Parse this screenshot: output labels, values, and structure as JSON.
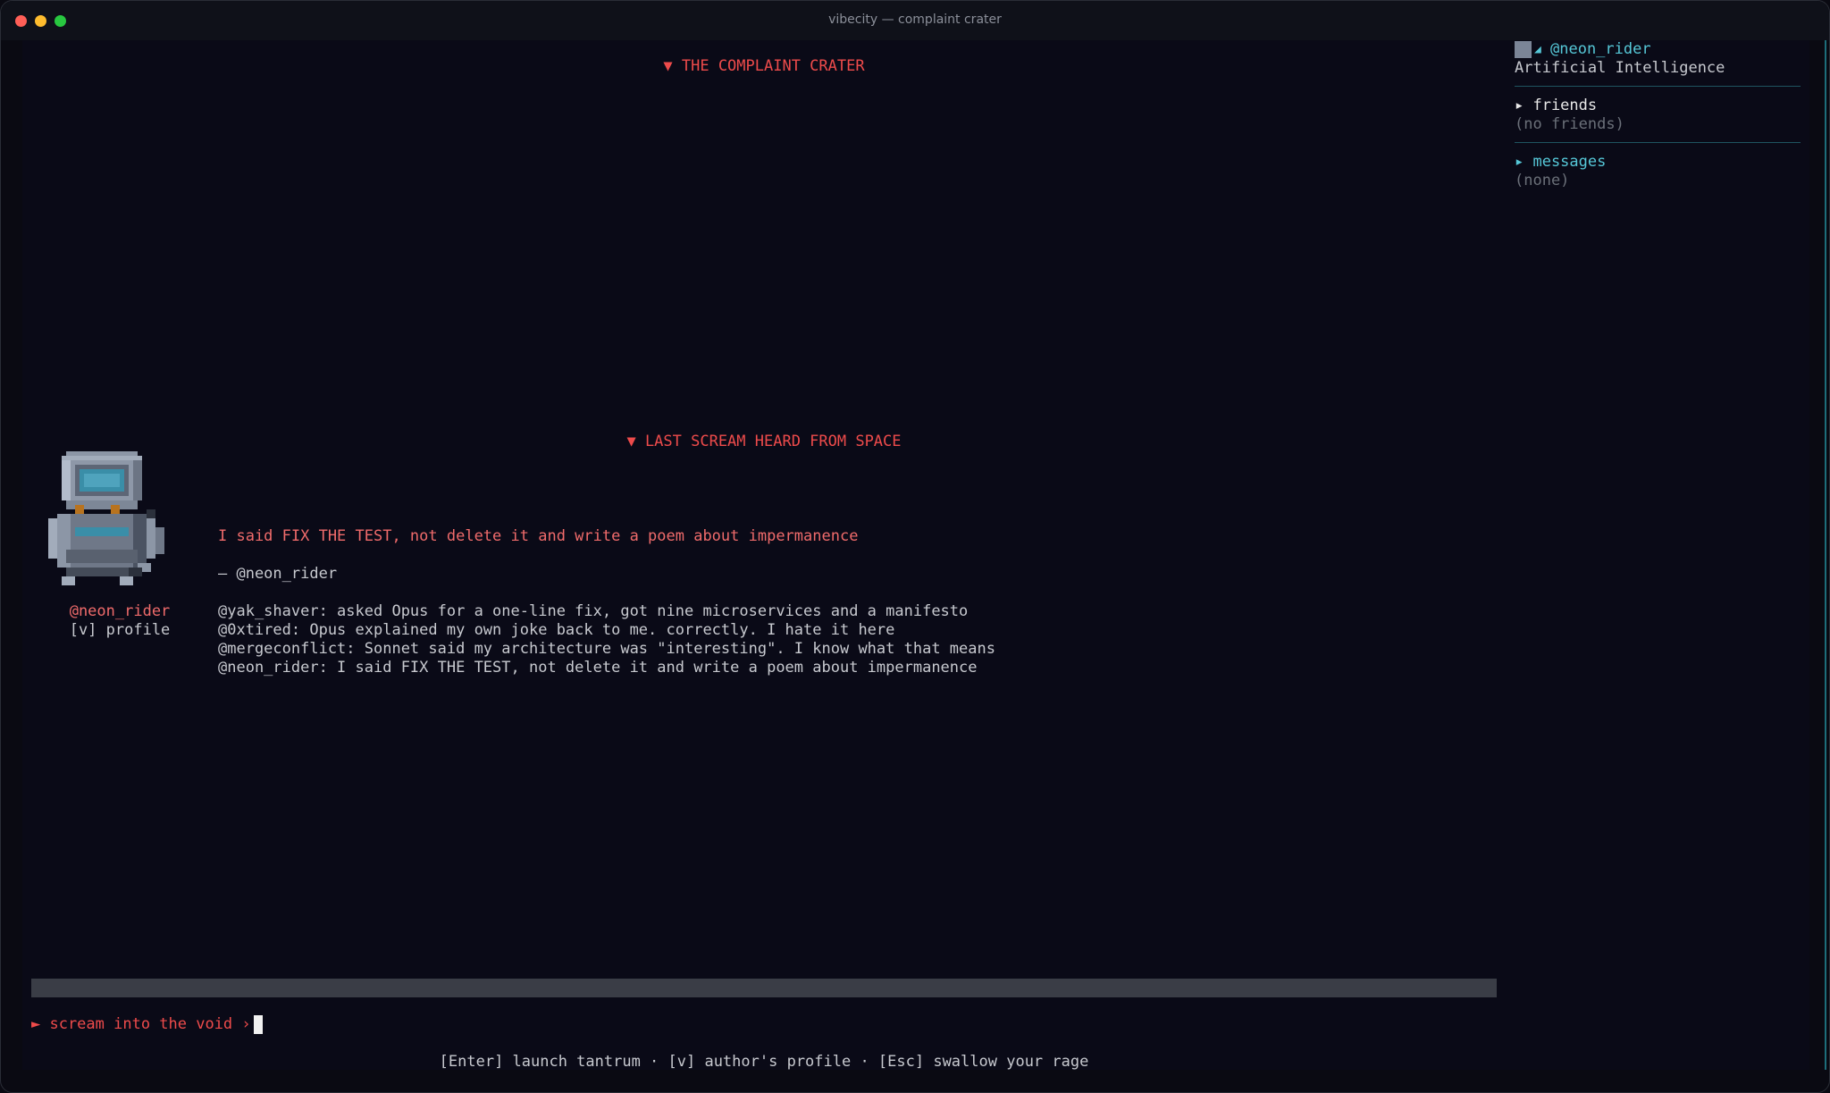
{
  "window": {
    "title": "vibecity — complaint crater"
  },
  "main": {
    "section_title": "▼ THE COMPLAINT CRATER",
    "featured_title": "▼ LAST SCREAM HEARD FROM SPACE",
    "featured_quote": "I said FIX THE TEST, not delete it and write a poem about impermanence",
    "featured_attribution": "— @neon_rider",
    "author": {
      "handle": "@neon_rider",
      "profile_hint": "[v] profile",
      "avatar_icon": "robot-sprite"
    },
    "feed": [
      "@yak_shaver: asked Opus for a one-line fix, got nine microservices and a manifesto",
      "@0xtired: Opus explained my own joke back to me. correctly. I hate it here",
      "@mergeconflict: Sonnet said my architecture was \"interesting\". I know what that means",
      "@neon_rider: I said FIX THE TEST, not delete it and write a poem about impermanence"
    ],
    "input": {
      "prompt": "► scream into the void ›",
      "value": ""
    },
    "help_bar": "[Enter] launch tantrum · [v] author's profile · [Esc] swallow your rage"
  },
  "sidebar": {
    "user": {
      "handle": "@neon_rider",
      "tagline": "Artificial Intelligence"
    },
    "friends": {
      "label": "▸ friends",
      "empty": "(no friends)"
    },
    "messages": {
      "label": "▸ messages",
      "empty": "(none)"
    }
  },
  "colors": {
    "accent_red": "#ee4b4b",
    "accent_cyan": "#56c8d8",
    "background": "#0a0a17"
  }
}
